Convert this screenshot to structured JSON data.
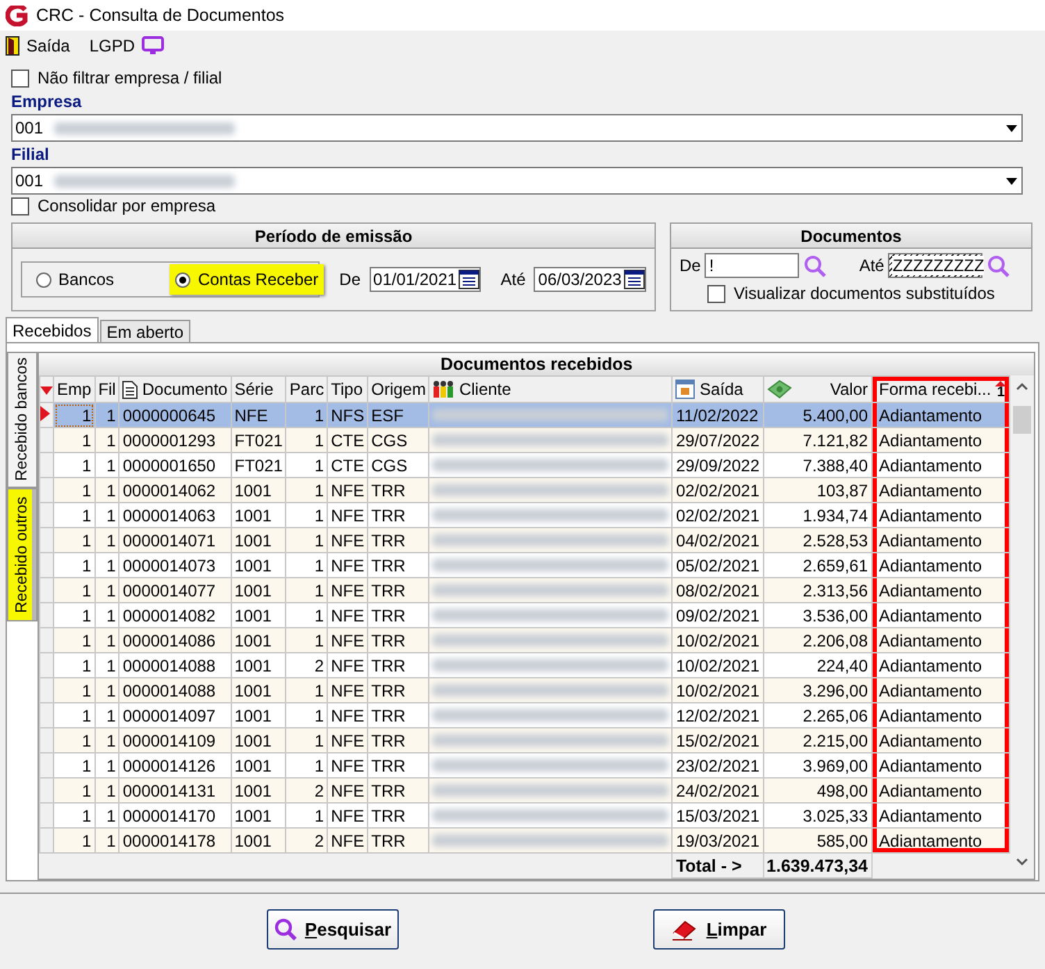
{
  "window": {
    "title": "CRC - Consulta de Documentos"
  },
  "toolbar": [
    {
      "label": "Saída",
      "kind": "exit"
    },
    {
      "label": "LGPD",
      "kind": "monitor"
    }
  ],
  "filters": {
    "no_filter": {
      "label": "Não filtrar empresa / filial",
      "checked": false
    },
    "empresa": {
      "label": "Empresa",
      "value": "001"
    },
    "filial": {
      "label": "Filial",
      "value": "001"
    },
    "consolidate": {
      "label": "Consolidar por empresa",
      "checked": false
    }
  },
  "period": {
    "title": "Período de emissão",
    "options": [
      {
        "label": "Bancos",
        "selected": false,
        "highlighted": false
      },
      {
        "label": "Contas Receber",
        "selected": true,
        "highlighted": true
      }
    ],
    "from_label": "De",
    "from": "01/01/2021",
    "to_label": "Até",
    "to": "06/03/2023"
  },
  "documents": {
    "title": "Documentos",
    "from_label": "De",
    "from": "!",
    "to_label": "Até",
    "to": "ZZZZZZZZZ",
    "show_replaced": {
      "label": "Visualizar documentos substituídos",
      "checked": false
    }
  },
  "tabs": [
    {
      "label": "Recebidos",
      "selected": true
    },
    {
      "label": "Em aberto",
      "selected": false
    }
  ],
  "side_tabs": [
    {
      "label": "Recebido bancos",
      "selected": true,
      "highlighted": false
    },
    {
      "label": "Recebido outros",
      "selected": false,
      "highlighted": true
    }
  ],
  "grid": {
    "title": "Documentos recebidos",
    "columns": [
      {
        "label": "Emp"
      },
      {
        "label": "Fil"
      },
      {
        "label": "Documento",
        "kind": "document"
      },
      {
        "label": "Série"
      },
      {
        "label": "Parc"
      },
      {
        "label": "Tipo"
      },
      {
        "label": "Origem"
      },
      {
        "label": "Cliente",
        "kind": "people"
      },
      {
        "label": "Saída",
        "kind": "calendar"
      },
      {
        "label": "Valor",
        "kind": "money"
      },
      {
        "label": "Forma recebi...",
        "annotated": true,
        "sort_order": "1"
      }
    ],
    "rows": [
      {
        "selected": true,
        "cells": [
          "1",
          "1",
          "0000000645",
          "NFE",
          "1",
          "NFS",
          "ESF",
          "",
          "11/02/2022",
          "5.400,00",
          "Adiantamento"
        ]
      },
      {
        "selected": false,
        "cells": [
          "1",
          "1",
          "0000001293",
          "FT021",
          "1",
          "CTE",
          "CGS",
          "",
          "29/07/2022",
          "7.121,82",
          "Adiantamento"
        ]
      },
      {
        "selected": false,
        "cells": [
          "1",
          "1",
          "0000001650",
          "FT021",
          "1",
          "CTE",
          "CGS",
          "",
          "29/09/2022",
          "7.388,40",
          "Adiantamento"
        ]
      },
      {
        "selected": false,
        "cells": [
          "1",
          "1",
          "0000014062",
          "1001",
          "1",
          "NFE",
          "TRR",
          "",
          "02/02/2021",
          "103,87",
          "Adiantamento"
        ]
      },
      {
        "selected": false,
        "cells": [
          "1",
          "1",
          "0000014063",
          "1001",
          "1",
          "NFE",
          "TRR",
          "",
          "02/02/2021",
          "1.934,74",
          "Adiantamento"
        ]
      },
      {
        "selected": false,
        "cells": [
          "1",
          "1",
          "0000014071",
          "1001",
          "1",
          "NFE",
          "TRR",
          "",
          "04/02/2021",
          "2.528,53",
          "Adiantamento"
        ]
      },
      {
        "selected": false,
        "cells": [
          "1",
          "1",
          "0000014073",
          "1001",
          "1",
          "NFE",
          "TRR",
          "",
          "05/02/2021",
          "2.659,61",
          "Adiantamento"
        ]
      },
      {
        "selected": false,
        "cells": [
          "1",
          "1",
          "0000014077",
          "1001",
          "1",
          "NFE",
          "TRR",
          "",
          "08/02/2021",
          "2.313,56",
          "Adiantamento"
        ]
      },
      {
        "selected": false,
        "cells": [
          "1",
          "1",
          "0000014082",
          "1001",
          "1",
          "NFE",
          "TRR",
          "",
          "09/02/2021",
          "3.536,00",
          "Adiantamento"
        ]
      },
      {
        "selected": false,
        "cells": [
          "1",
          "1",
          "0000014086",
          "1001",
          "1",
          "NFE",
          "TRR",
          "",
          "10/02/2021",
          "2.206,08",
          "Adiantamento"
        ]
      },
      {
        "selected": false,
        "cells": [
          "1",
          "1",
          "0000014088",
          "1001",
          "2",
          "NFE",
          "TRR",
          "",
          "10/02/2021",
          "224,40",
          "Adiantamento"
        ]
      },
      {
        "selected": false,
        "cells": [
          "1",
          "1",
          "0000014088",
          "1001",
          "1",
          "NFE",
          "TRR",
          "",
          "10/02/2021",
          "3.296,00",
          "Adiantamento"
        ]
      },
      {
        "selected": false,
        "cells": [
          "1",
          "1",
          "0000014097",
          "1001",
          "1",
          "NFE",
          "TRR",
          "",
          "12/02/2021",
          "2.265,06",
          "Adiantamento"
        ]
      },
      {
        "selected": false,
        "cells": [
          "1",
          "1",
          "0000014109",
          "1001",
          "1",
          "NFE",
          "TRR",
          "",
          "15/02/2021",
          "2.215,00",
          "Adiantamento"
        ]
      },
      {
        "selected": false,
        "cells": [
          "1",
          "1",
          "0000014126",
          "1001",
          "1",
          "NFE",
          "TRR",
          "",
          "23/02/2021",
          "3.969,00",
          "Adiantamento"
        ]
      },
      {
        "selected": false,
        "cells": [
          "1",
          "1",
          "0000014131",
          "1001",
          "2",
          "NFE",
          "TRR",
          "",
          "24/02/2021",
          "498,00",
          "Adiantamento"
        ]
      },
      {
        "selected": false,
        "cells": [
          "1",
          "1",
          "0000014170",
          "1001",
          "1",
          "NFE",
          "TRR",
          "",
          "15/03/2021",
          "3.025,33",
          "Adiantamento"
        ]
      },
      {
        "selected": false,
        "cells": [
          "1",
          "1",
          "0000014178",
          "1001",
          "2",
          "NFE",
          "TRR",
          "",
          "19/03/2021",
          "585,00",
          "Adiantamento"
        ]
      }
    ],
    "total_label": "Total - >",
    "total": "1.639.473,34"
  },
  "buttons": [
    {
      "label": "Pesquisar",
      "kind": "search"
    },
    {
      "label": "Limpar",
      "kind": "clear"
    }
  ]
}
